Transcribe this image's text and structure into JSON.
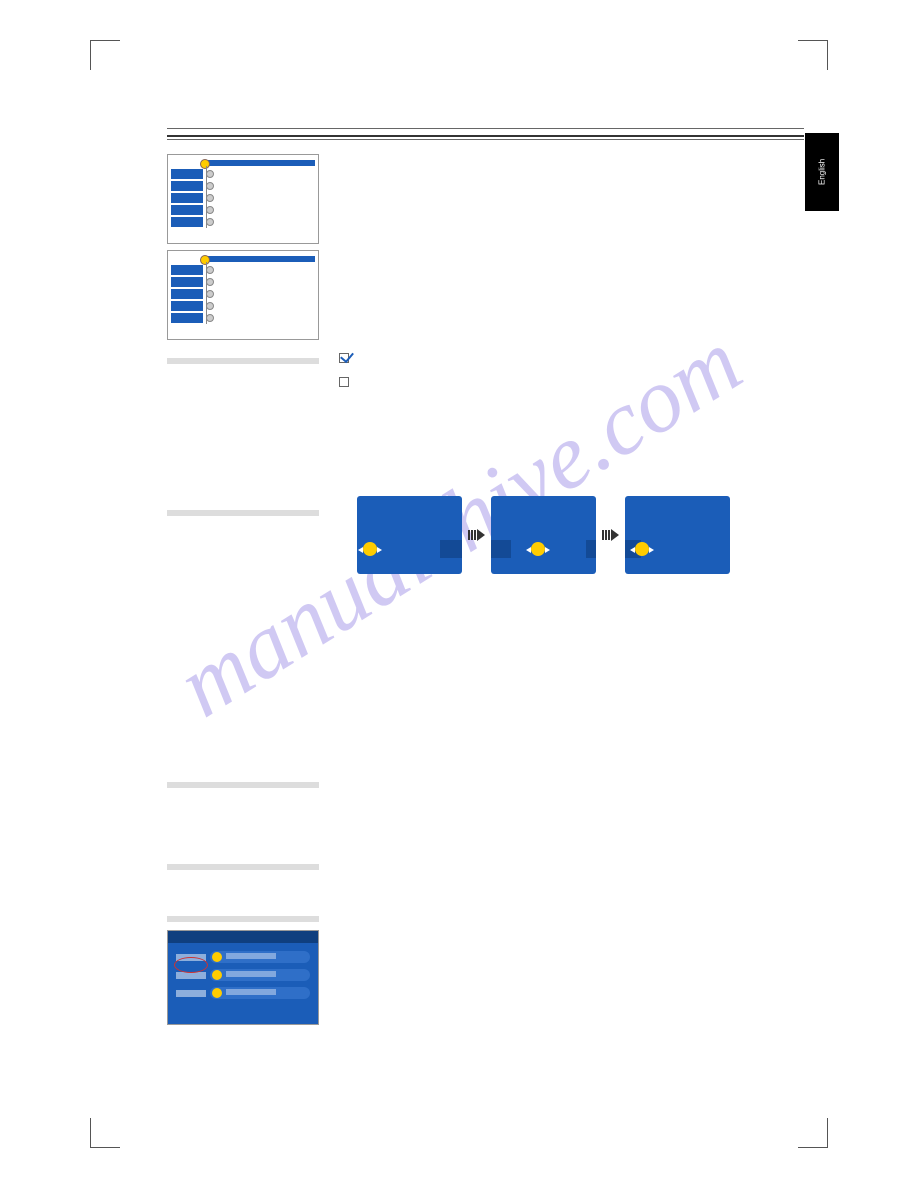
{
  "header": {
    "left": "",
    "right": ""
  },
  "sideTab": "English",
  "pageNumber": "",
  "thumbs": {
    "menu_items": [
      "",
      "",
      "",
      "",
      ""
    ]
  },
  "sections": {
    "s1": {
      "label": "",
      "body": ""
    },
    "checkbox1": {
      "checked": true,
      "text": ""
    },
    "checkbox2": {
      "checked": false,
      "text": ""
    },
    "s2": {
      "label": "",
      "body": ""
    },
    "diagram_intro": "",
    "diagram_after": "",
    "s3": {
      "label": "",
      "body": ""
    },
    "s4": {
      "label": "",
      "body": ""
    },
    "s5": {
      "label": "",
      "body": ""
    }
  },
  "wizard": {
    "options": [
      "",
      "",
      ""
    ]
  },
  "watermark": "manualshive.com"
}
